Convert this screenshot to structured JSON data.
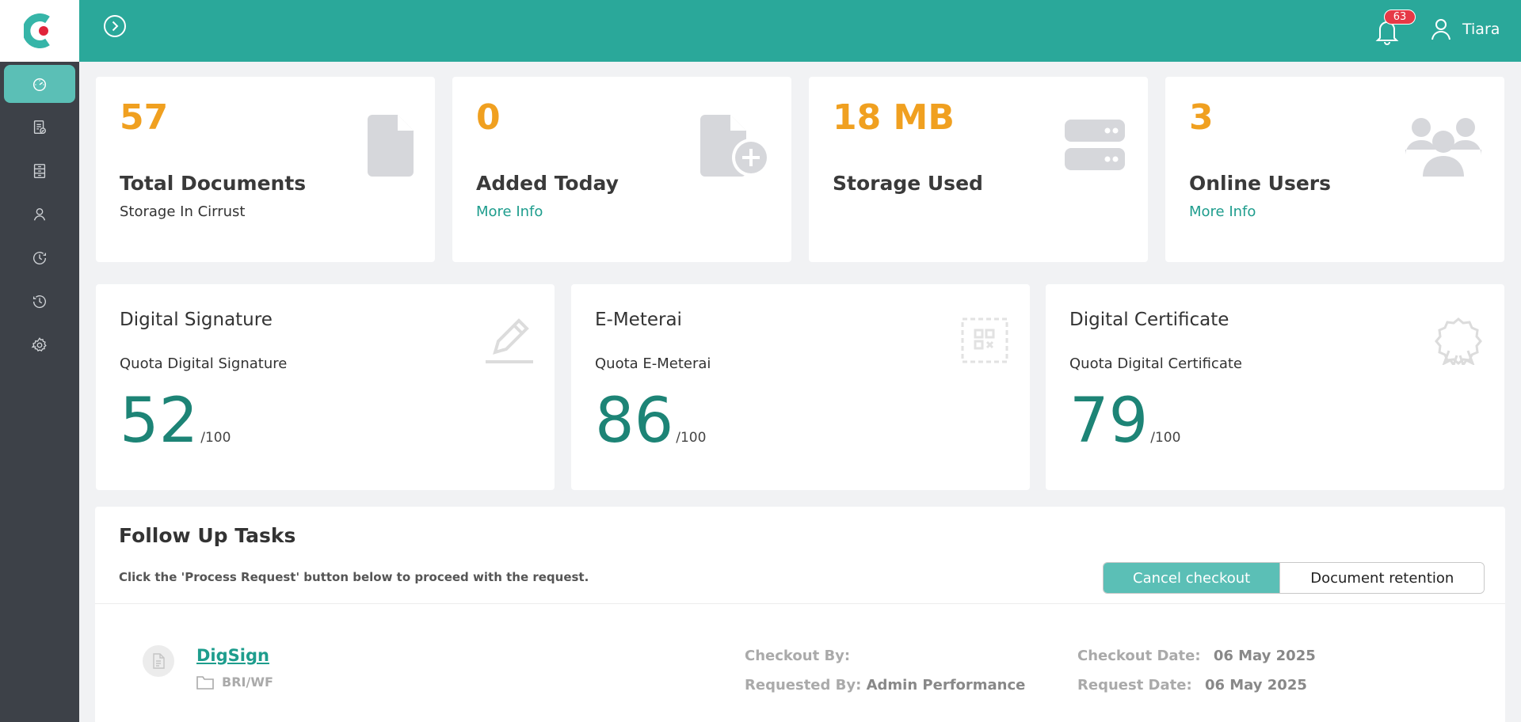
{
  "header": {
    "notification_count": "63",
    "user_name": "Tiara"
  },
  "sidebar": {
    "items": [
      {
        "icon": "dashboard-icon",
        "active": true
      },
      {
        "icon": "document-check-icon",
        "active": false
      },
      {
        "icon": "archive-icon",
        "active": false
      },
      {
        "icon": "user-icon",
        "active": false
      },
      {
        "icon": "history-icon",
        "active": false
      },
      {
        "icon": "clock-icon",
        "active": false
      },
      {
        "icon": "gear-icon",
        "active": false
      }
    ]
  },
  "stats": [
    {
      "value": "57",
      "title": "Total Documents",
      "sub": "Storage In Cirrust",
      "icon": "document-icon"
    },
    {
      "value": "0",
      "title": "Added Today",
      "sub": "More Info",
      "icon": "document-add-icon"
    },
    {
      "value": "18 MB",
      "title": "Storage Used",
      "sub": "",
      "icon": "server-icon"
    },
    {
      "value": "3",
      "title": "Online Users",
      "sub": "More Info",
      "icon": "users-icon"
    }
  ],
  "quotas": [
    {
      "title": "Digital Signature",
      "sub": "Quota Digital Signature",
      "value": "52",
      "total": "/100",
      "icon": "pen-icon"
    },
    {
      "title": "E-Meterai",
      "sub": "Quota E-Meterai",
      "value": "86",
      "total": "/100",
      "icon": "stamp-qr-icon"
    },
    {
      "title": "Digital Certificate",
      "sub": "Quota Digital Certificate",
      "value": "79",
      "total": "/100",
      "icon": "badge-icon"
    }
  ],
  "tasks": {
    "title": "Follow Up Tasks",
    "hint": "Click the 'Process Request' button below to proceed with the request.",
    "buttons": {
      "cancel_checkout": "Cancel checkout",
      "document_retention": "Document retention"
    },
    "rows": [
      {
        "name": "DigSign",
        "folder": "BRI/WF",
        "checkout_by_label": "Checkout By:",
        "checkout_by": "",
        "requested_by_label": "Requested By:",
        "requested_by": "Admin Performance",
        "checkout_date_label": "Checkout Date:",
        "checkout_date": "06 May 2025",
        "request_date_label": "Request Date:",
        "request_date": "06 May 2025"
      }
    ]
  },
  "colors": {
    "primary": "#2aa89a",
    "accent": "#f0a020",
    "sidebar": "#3d4148",
    "quota": "#1d8476"
  }
}
